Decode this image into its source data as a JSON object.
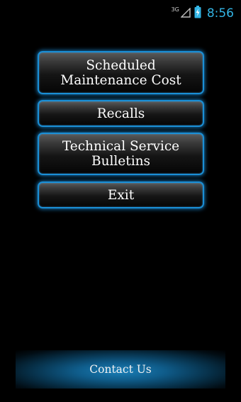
{
  "status_bar": {
    "network_type": "3G",
    "time": "8:56",
    "clock_color": "#33b5e5"
  },
  "menu": {
    "scheduled_maintenance_label": "Scheduled Maintenance Cost",
    "recalls_label": "Recalls",
    "tsb_label": "Technical Service Bulletins",
    "exit_label": "Exit"
  },
  "footer": {
    "contact_label": "Contact Us"
  },
  "colors": {
    "accent": "#1a8fd6",
    "background": "#000000"
  }
}
